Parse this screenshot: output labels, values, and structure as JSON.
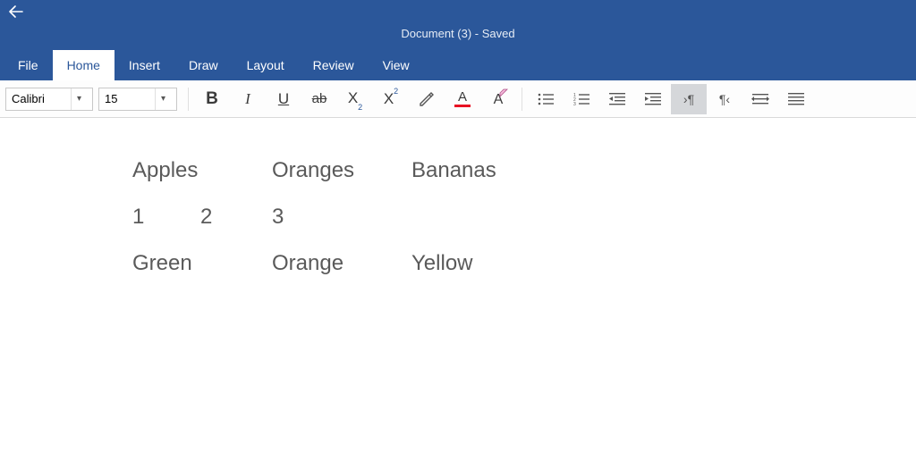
{
  "title": "Document (3) - Saved",
  "tabs": {
    "file": "File",
    "home": "Home",
    "insert": "Insert",
    "draw": "Draw",
    "layout": "Layout",
    "review": "Review",
    "view": "View"
  },
  "ribbon": {
    "font_name": "Calibri",
    "font_size": "15",
    "bold": "B",
    "italic": "I",
    "underline": "U",
    "strike": "ab",
    "subscript_base": "X",
    "subscript_sub": "2",
    "superscript_base": "X",
    "superscript_sup": "2",
    "fontcolor_letter": "A",
    "clearformat_letter": "A",
    "pilcrow_show": "¶",
    "pilcrow_hide": "¶"
  },
  "document": {
    "row1": {
      "c1": "Apples",
      "c2": "Oranges",
      "c3": "Bananas"
    },
    "row2": {
      "c1": "1",
      "c2": "2",
      "c3": "3"
    },
    "row3": {
      "c1": "Green",
      "c2": "Orange",
      "c3": "Yellow"
    }
  }
}
